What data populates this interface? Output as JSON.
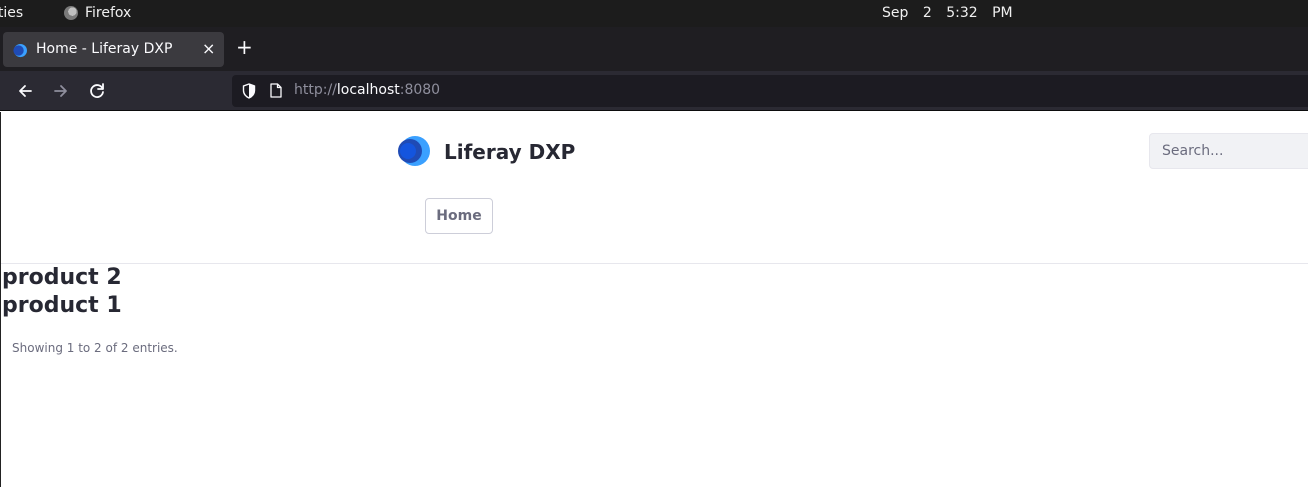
{
  "system_bar": {
    "activities": "ities",
    "app_name": "Firefox",
    "date": "Sep 2",
    "time": "5:32 PM"
  },
  "browser": {
    "tab": {
      "title": "Home - Liferay DXP",
      "close": "×"
    },
    "new_tab": "+",
    "url_prefix": "http://",
    "url_host": "localhost",
    "url_port": ":8080"
  },
  "site": {
    "name": "Liferay DXP",
    "search_placeholder": "Search...",
    "nav": {
      "home": "Home"
    }
  },
  "content": {
    "products": [
      "product 2",
      "product 1"
    ],
    "entries_text": "Showing 1 to 2 of 2 entries."
  },
  "colors": {
    "brand_blue": "#0b5fff",
    "logo_dark": "#1f4bb5",
    "logo_light": "#3aa0ff"
  }
}
